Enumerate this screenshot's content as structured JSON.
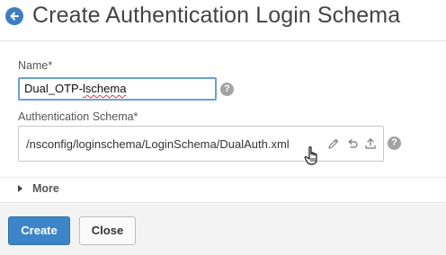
{
  "header": {
    "title": "Create Authentication Login Schema",
    "back_icon": "arrow-left-circle-icon"
  },
  "form": {
    "name": {
      "label": "Name*",
      "value_prefix": "Dual_OTP-",
      "value_misspelled": "lschema",
      "help": "?"
    },
    "schema": {
      "label": "Authentication Schema*",
      "value": "/nsconfig/loginschema/LoginSchema/DualAuth.xml",
      "help": "?",
      "actions": [
        "pencil-icon",
        "undo-icon",
        "upload-icon"
      ]
    },
    "more": {
      "label": "More"
    }
  },
  "footer": {
    "create_label": "Create",
    "close_label": "Close"
  },
  "colors": {
    "primary": "#3d85c8",
    "back_button": "#3d7ec3",
    "input_focus_border": "#6a9fd9",
    "help_icon": "#a3a3a3"
  }
}
